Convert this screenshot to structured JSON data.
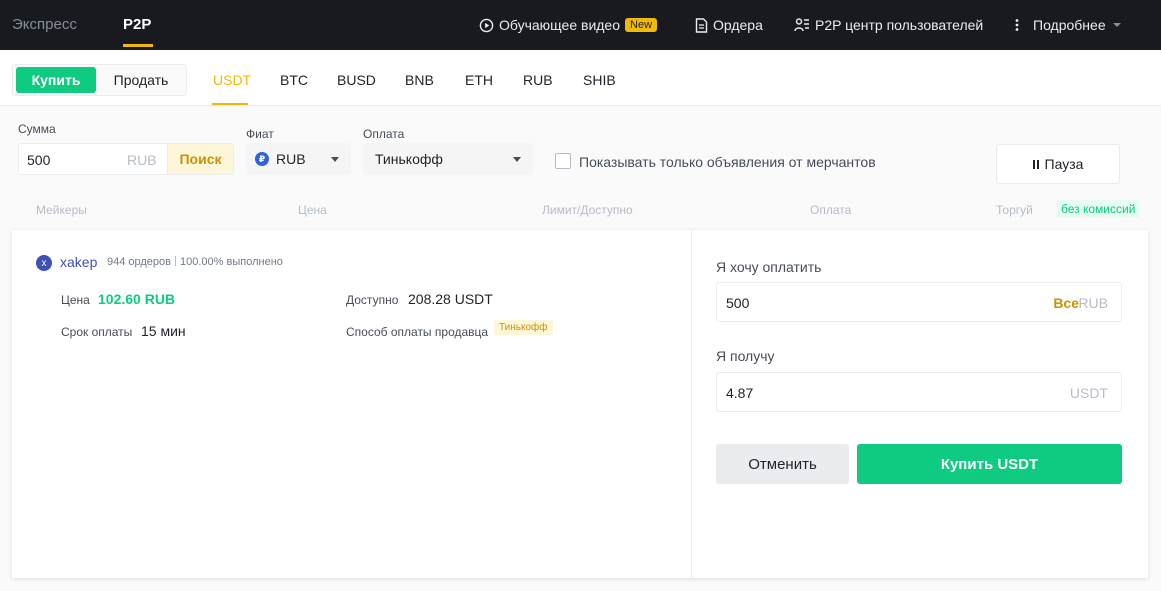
{
  "topbar": {
    "tab_express": "Экспресс",
    "tab_p2p": "P2P",
    "video_label": "Обучающее видео",
    "new_badge": "New",
    "orders_label": "Ордера",
    "p2p_center_label": "P2P центр пользователей",
    "more_label": "Подробнее"
  },
  "trade_toggle": {
    "buy": "Купить",
    "sell": "Продать"
  },
  "coins": [
    "USDT",
    "BTC",
    "BUSD",
    "BNB",
    "ETH",
    "RUB",
    "SHIB"
  ],
  "filters": {
    "amount_label": "Сумма",
    "amount_value": "500",
    "amount_unit": "RUB",
    "search_button": "Поиск",
    "fiat_label": "Фиат",
    "fiat_value": "RUB",
    "fiat_symbol": "₽",
    "payment_label": "Оплата",
    "payment_value": "Тинькофф",
    "merchant_only_label": "Показывать только объявления от мерчантов",
    "pause_button": "Пауза"
  },
  "columns": {
    "makers": "Мейкеры",
    "price": "Цена",
    "limit": "Лимит/Доступно",
    "payment": "Оплата",
    "trade": "Торгуй",
    "no_fee": "без комиссий"
  },
  "offer": {
    "avatar_letter": "x",
    "maker": "xakep",
    "orders": "944 ордеров",
    "completion": "100.00% выполнено",
    "price_label": "Цена",
    "price_value": "102.60 RUB",
    "available_label": "Доступно",
    "available_value": "208.28 USDT",
    "pay_time_label": "Срок оплаты",
    "pay_time_value": "15 мин",
    "seller_payment_label": "Способ оплаты продавца",
    "seller_payment_value": "Тинькофф"
  },
  "order_form": {
    "pay_label": "Я хочу оплатить",
    "pay_value": "500",
    "pay_all": "Все",
    "pay_unit": "RUB",
    "receive_label": "Я получу",
    "receive_value": "4.87",
    "receive_unit": "USDT",
    "cancel_button": "Отменить",
    "buy_button": "Купить USDT"
  },
  "colors": {
    "accent": "#f0b90b",
    "buy_green": "#0ecb81",
    "topbar_bg": "#181a20"
  }
}
